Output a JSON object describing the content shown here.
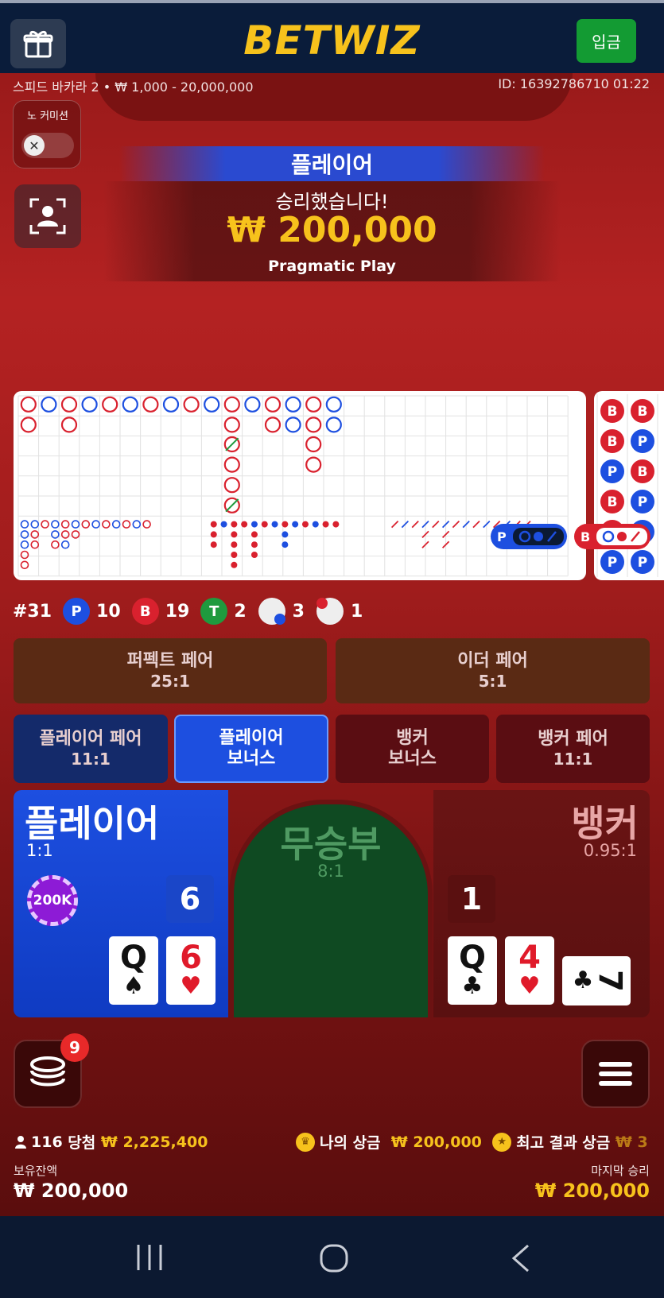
{
  "header": {
    "logo": "BETWIZ",
    "deposit_label": "입금"
  },
  "table": {
    "info": "스피드 바카라 2 • ₩ 1,000 - 20,000,000",
    "id": "ID: 16392786710 01:22",
    "no_commission_label": "노 커미션"
  },
  "win_banner": {
    "title": "플레이어",
    "message": "승리했습니다!",
    "amount": "₩ 200,000",
    "provider": "Pragmatic Play"
  },
  "stats": {
    "round": "#31",
    "player_badge": "P",
    "player_count": "10",
    "banker_badge": "B",
    "banker_count": "19",
    "tie_badge": "T",
    "tie_count": "2",
    "player_pair_count": "3",
    "banker_pair_count": "1",
    "predict_player": "P",
    "predict_banker": "B"
  },
  "side_bets": [
    {
      "title": "퍼펙트 페어",
      "odds": "25:1"
    },
    {
      "title": "이더 페어",
      "odds": "5:1"
    },
    {
      "title": "플레이어 페어",
      "odds": "11:1"
    },
    {
      "title_line1": "플레이어",
      "title_line2": "보너스"
    },
    {
      "title_line1": "뱅커",
      "title_line2": "보너스"
    },
    {
      "title": "뱅커 페어",
      "odds": "11:1"
    }
  ],
  "main_bets": {
    "player": {
      "title": "플레이어",
      "odds": "1:1",
      "score": "6",
      "chip": "200K",
      "cards": [
        {
          "rank": "Q",
          "suit": "♠"
        },
        {
          "rank": "6",
          "suit": "♥"
        }
      ]
    },
    "tie": {
      "title": "무승부",
      "odds": "8:1"
    },
    "banker": {
      "title": "뱅커",
      "odds": "0.95:1",
      "score": "1",
      "cards": [
        {
          "rank": "Q",
          "suit": "♣"
        },
        {
          "rank": "4",
          "suit": "♥"
        },
        {
          "rank": "7",
          "suit": "♣"
        }
      ]
    }
  },
  "controls": {
    "chips_icon": "chip-stack-icon",
    "notification_count": "9",
    "menu_icon": "hamburger-icon"
  },
  "footer": {
    "winners_count": "116",
    "winners_label": "당첨",
    "winners_amount": "₩ 2,225,400",
    "my_win_label": "나의 상금",
    "my_win_amount": "₩ 200,000",
    "best_label": "최고 결과 상금",
    "best_amount": "₩ 3",
    "balance_label": "보유잔액",
    "balance_value": "₩ 200,000",
    "last_win_label": "마지막 승리",
    "last_win_value": "₩ 200,000"
  },
  "bead_road": [
    [
      "B",
      "B"
    ],
    [
      "B",
      "P"
    ],
    [
      "P",
      "B"
    ],
    [
      "B",
      "P"
    ],
    [
      "B",
      "P"
    ],
    [
      "P",
      "P"
    ]
  ],
  "colors": {
    "player_blue": "#1d4fe0",
    "banker_red": "#d9212e",
    "tie_green": "#1f9a3e",
    "gold": "#f7c21c"
  }
}
